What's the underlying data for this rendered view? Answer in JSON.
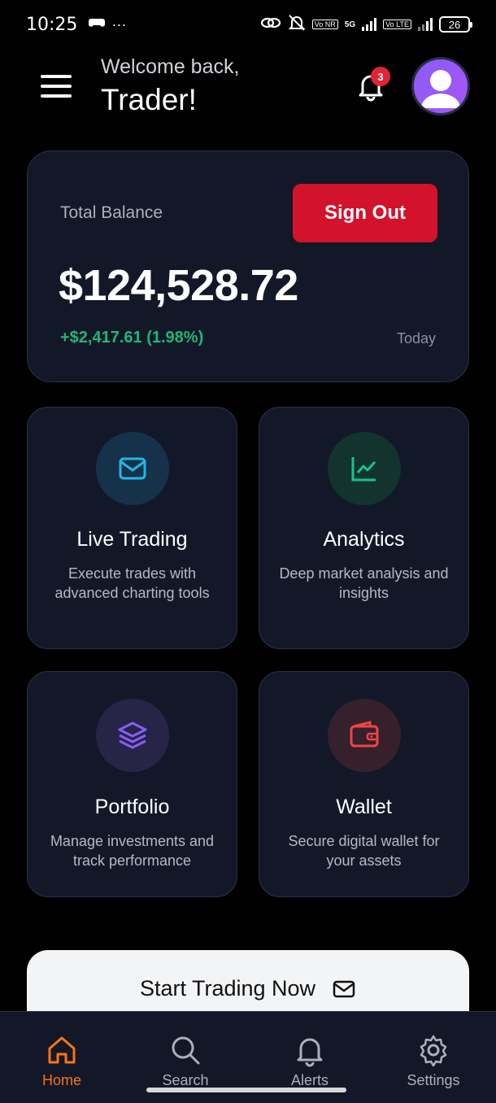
{
  "status_bar": {
    "time": "10:25",
    "dots": "···",
    "net1": "Vo NR",
    "net2": "5G",
    "net3": "Vo LTE",
    "battery": "26"
  },
  "header": {
    "welcome": "Welcome back,",
    "name": "Trader!",
    "notification_count": "3"
  },
  "balance": {
    "label": "Total Balance",
    "sign_out": "Sign Out",
    "amount": "$124,528.72",
    "change": "+$2,417.61 (1.98%)",
    "period": "Today"
  },
  "features": [
    {
      "title": "Live Trading",
      "desc": "Execute trades with advanced charting tools",
      "icon": "mail-icon",
      "color": "#22b8e6"
    },
    {
      "title": "Analytics",
      "desc": "Deep market analysis and insights",
      "icon": "chart-line-icon",
      "color": "#16c58a"
    },
    {
      "title": "Portfolio",
      "desc": "Manage investments and track performance",
      "icon": "layers-icon",
      "color": "#8b5cf6"
    },
    {
      "title": "Wallet",
      "desc": "Secure digital wallet for your assets",
      "icon": "wallet-icon",
      "color": "#ef4444"
    }
  ],
  "start_trading": {
    "label": "Start Trading Now"
  },
  "nav": [
    {
      "label": "Home",
      "icon": "home-icon",
      "active": true
    },
    {
      "label": "Search",
      "icon": "search-icon",
      "active": false
    },
    {
      "label": "Alerts",
      "icon": "bell-icon",
      "active": false
    },
    {
      "label": "Settings",
      "icon": "gear-icon",
      "active": false
    }
  ],
  "colors": {
    "accent": "#f97316",
    "danger": "#d3122b",
    "positive": "#22b573",
    "card_bg": "#131829"
  }
}
